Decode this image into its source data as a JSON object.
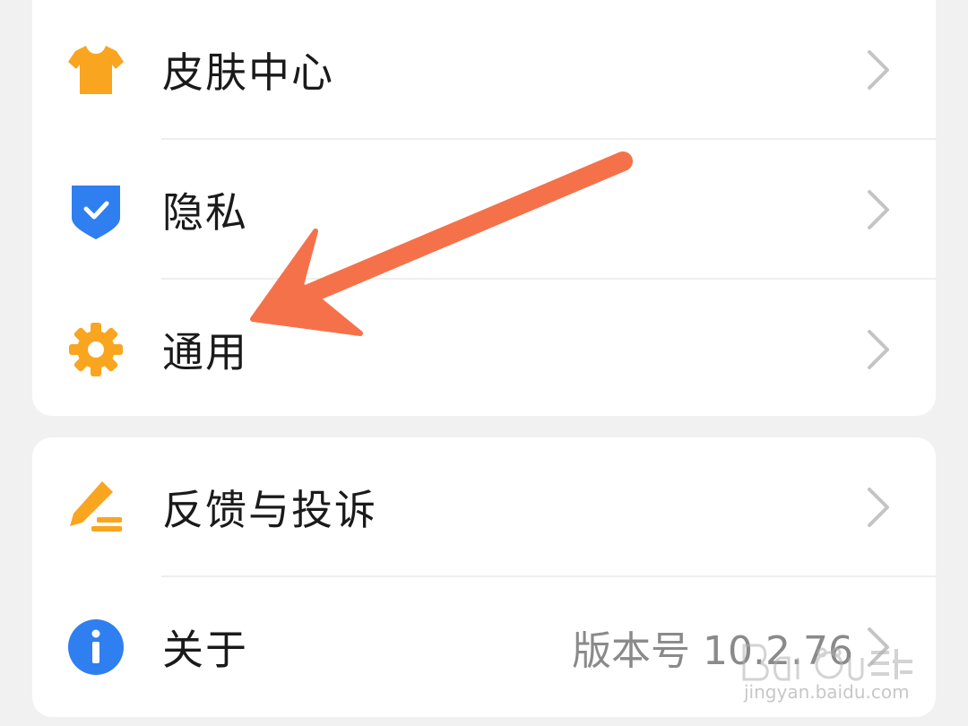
{
  "settings_group_1": [
    {
      "label": "皮肤中心",
      "icon": "tshirt-icon",
      "icon_color": "#F9A51F"
    },
    {
      "label": "隐私",
      "icon": "shield-check-icon",
      "icon_color": "#2F7FF0"
    },
    {
      "label": "通用",
      "icon": "gear-icon",
      "icon_color": "#F9A51F"
    }
  ],
  "settings_group_2": [
    {
      "label": "反馈与投诉",
      "icon": "pencil-feedback-icon",
      "icon_color": "#F9A51F"
    },
    {
      "label": "关于",
      "icon": "info-icon",
      "icon_color": "#2F7FF0",
      "value": "版本号 10.2.76"
    }
  ],
  "annotation": {
    "type": "arrow",
    "color": "#F5714A",
    "target": "通用"
  },
  "watermark": {
    "url": "jingyan.baidu.com"
  }
}
